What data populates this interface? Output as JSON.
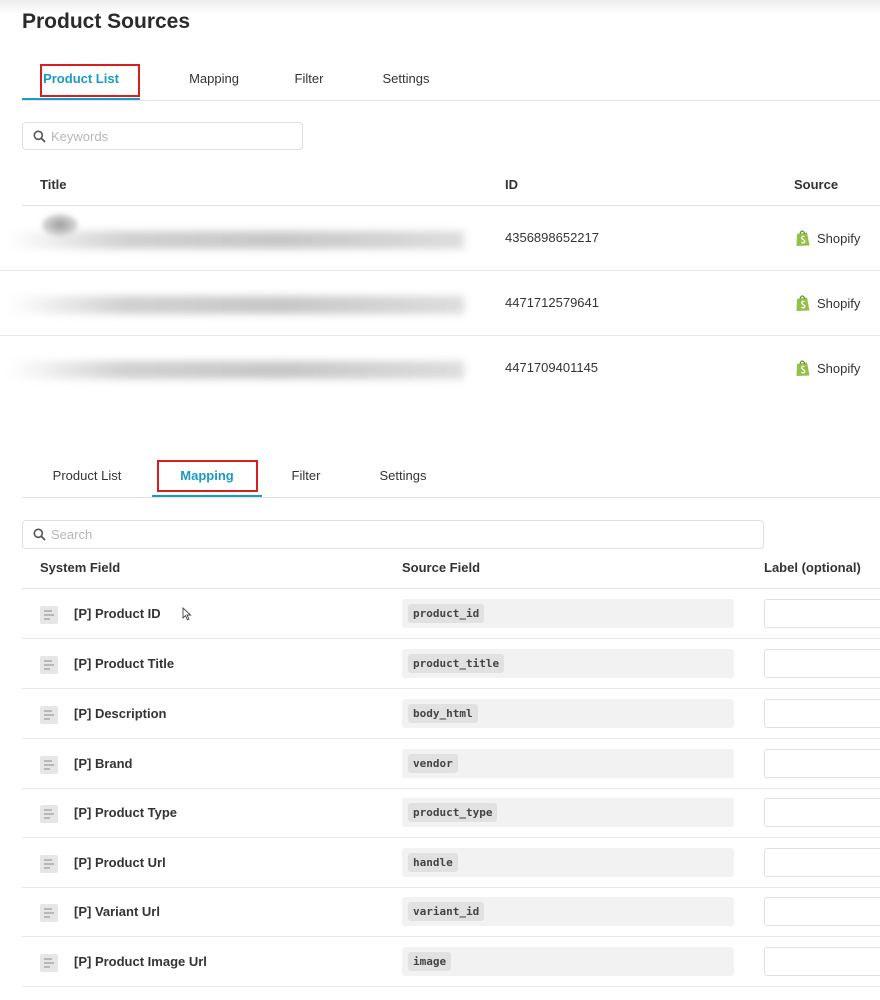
{
  "page": {
    "title": "Product Sources"
  },
  "tabs_top": {
    "items": [
      "Product List",
      "Mapping",
      "Filter",
      "Settings"
    ],
    "active": "Product List"
  },
  "keywords_search": {
    "placeholder": "Keywords"
  },
  "product_table": {
    "columns": [
      "Title",
      "ID",
      "Source"
    ],
    "rows": [
      {
        "title": "",
        "id": "4356898652217",
        "source": "Shopify"
      },
      {
        "title": "",
        "id": "4471712579641",
        "source": "Shopify"
      },
      {
        "title": "",
        "id": "4471709401145",
        "source": "Shopify"
      }
    ]
  },
  "tabs_mapping": {
    "items": [
      "Product List",
      "Mapping",
      "Filter",
      "Settings"
    ],
    "active": "Mapping"
  },
  "mapping_search": {
    "placeholder": "Search"
  },
  "mapping_table": {
    "columns": [
      "System Field",
      "Source Field",
      "Label (optional)"
    ],
    "rows": [
      {
        "system_field": "[P] Product ID",
        "source_field": "product_id",
        "label": ""
      },
      {
        "system_field": "[P] Product Title",
        "source_field": "product_title",
        "label": ""
      },
      {
        "system_field": "[P] Description",
        "source_field": "body_html",
        "label": ""
      },
      {
        "system_field": "[P] Brand",
        "source_field": "vendor",
        "label": ""
      },
      {
        "system_field": "[P] Product Type",
        "source_field": "product_type",
        "label": ""
      },
      {
        "system_field": "[P] Product Url",
        "source_field": "handle",
        "label": ""
      },
      {
        "system_field": "[P] Variant Url",
        "source_field": "variant_id",
        "label": ""
      },
      {
        "system_field": "[P] Product Image Url",
        "source_field": "image",
        "label": ""
      }
    ]
  },
  "colors": {
    "accent": "#1a9bc2",
    "highlight": "#d81e1e",
    "shopify": "#95bf47"
  },
  "icons": {
    "search": "search-icon",
    "shopify": "shopify-icon",
    "drag": "drag-handle-icon",
    "cursor": "mouse-cursor-icon"
  }
}
